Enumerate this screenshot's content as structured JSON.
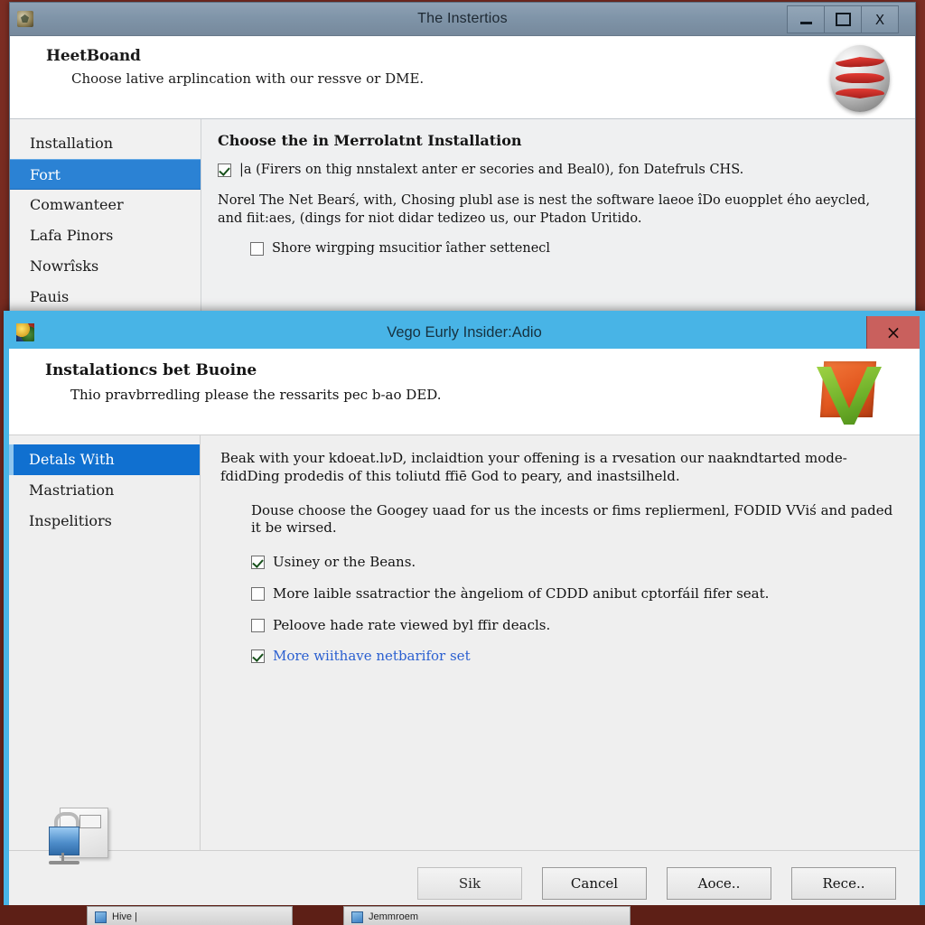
{
  "background_window": {
    "title": "The Instertios",
    "titlebar_icon": "app-icon",
    "controls": {
      "minimize": "–",
      "maximize": "□",
      "close": "X"
    },
    "header": {
      "title": "HeetBoand",
      "subtitle": "Choose lative arplincation with our ressve or DME.",
      "logo": "netbeans-ball-logo"
    },
    "sidebar": {
      "items": [
        {
          "label": "Installation",
          "selected": false
        },
        {
          "label": "Fort",
          "selected": true
        },
        {
          "label": "Comwanteer",
          "selected": false
        },
        {
          "label": "Lafa Pinors",
          "selected": false
        },
        {
          "label": "Nowrîsks",
          "selected": false
        },
        {
          "label": "Pauis",
          "selected": false
        }
      ]
    },
    "content": {
      "title": "Choose the in Merrolatnt Installation",
      "checkbox_top": {
        "label": "|a (Firers on thig nnstalext anter er secories and Beal0), fon Datefruls CHS.",
        "checked": true
      },
      "paragraph": "Norel The Net Bearś, with, Chosing plubl ase is nest the software laeoe îDo euopplet ého aeycled, and fiit:aes, (dings for niot didar tedizeo us, our Ptadon Uritido.",
      "checkbox_bottom": {
        "label": "Shore wirgping msucitior îather settenecl",
        "checked": false
      }
    }
  },
  "foreground_window": {
    "title": "Vego Eurly Insider:Adio",
    "titlebar_icon": "app-icon",
    "close_label": "×",
    "accent_color": "#48b4e6",
    "header": {
      "title": "Instalationcs bet Buoine",
      "subtitle": "Thio pravbrredling please the ressarits pec b-ao DED.",
      "logo": "orange-box-green-check-logo"
    },
    "sidebar": {
      "items": [
        {
          "label": "Detals With",
          "selected": true
        },
        {
          "label": "Mastriation",
          "selected": false
        },
        {
          "label": "Inspelitiors",
          "selected": false
        }
      ],
      "icon": "lock-document-icon"
    },
    "content": {
      "paragraph_1": "Beak with your kdoeat.lνD, inclaidtion your offening is a rvesation our naakndtarted mode-fdidDing prodedis of this toliutd ffiē God to peary, and inastsilheld.",
      "paragraph_2": "Douse choose the Googey uaad for us the incests or fims repliermenl, FODID VViś and paded it be wirsed.",
      "checkboxes": [
        {
          "label": "Usiney or the Beans.",
          "checked": true,
          "link": false
        },
        {
          "label": "More laible ssatractior the àngeliom of CDDD anibut cptorfáil fifer seat.",
          "checked": false,
          "link": false
        },
        {
          "label": "Peloove hade rate viewed byl ffir deacls.",
          "checked": false,
          "link": false
        },
        {
          "label": "More wiithave netbarifor set",
          "checked": true,
          "link": true
        }
      ]
    },
    "footer": {
      "buttons": [
        {
          "label": "Sik",
          "style": "weak"
        },
        {
          "label": "Cancel",
          "style": "normal"
        },
        {
          "label": "Aoce..",
          "style": "normal"
        },
        {
          "label": "Rece..",
          "style": "normal"
        }
      ]
    }
  },
  "taskbar": {
    "tasks": [
      {
        "label": "Hive |"
      },
      {
        "label": "Jemmroem"
      }
    ]
  }
}
